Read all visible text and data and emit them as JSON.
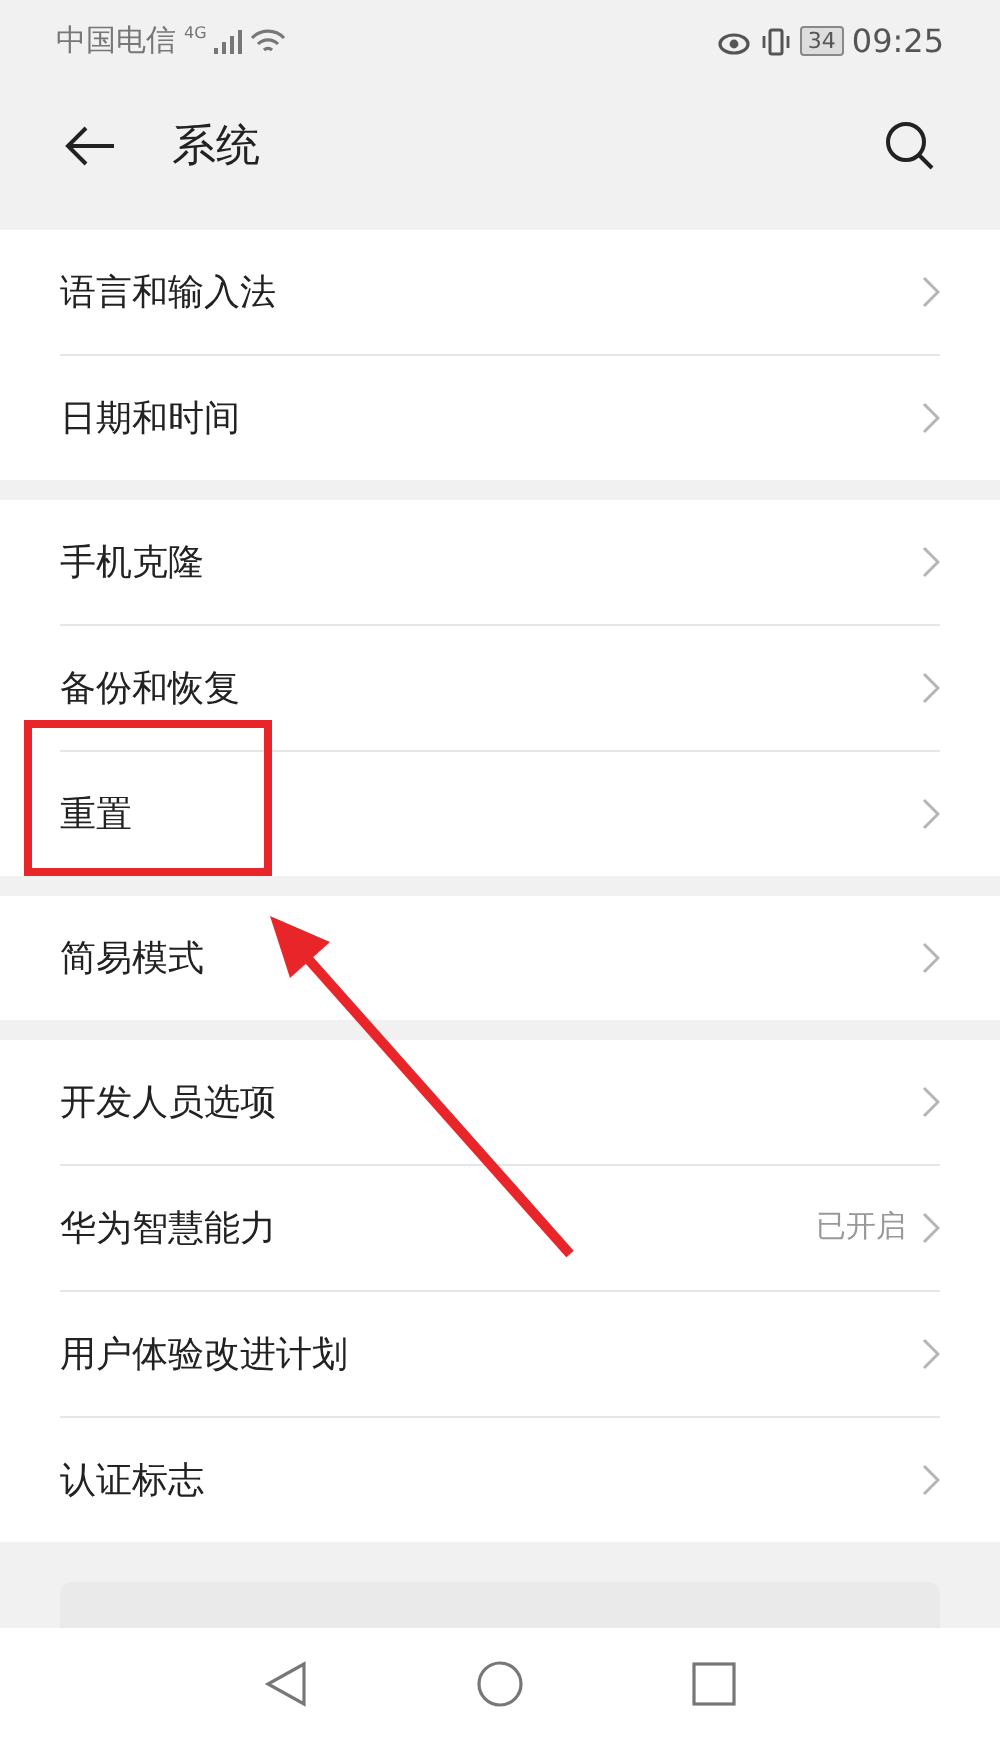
{
  "status_bar": {
    "carrier": "中国电信",
    "network": "4G",
    "battery": "34",
    "time": "09:25"
  },
  "header": {
    "title": "系统"
  },
  "groups": [
    {
      "items": [
        {
          "label": "语言和输入法"
        },
        {
          "label": "日期和时间"
        }
      ]
    },
    {
      "items": [
        {
          "label": "手机克隆"
        },
        {
          "label": "备份和恢复"
        },
        {
          "label": "重置"
        }
      ]
    },
    {
      "items": [
        {
          "label": "简易模式"
        }
      ]
    },
    {
      "items": [
        {
          "label": "开发人员选项"
        },
        {
          "label": "华为智慧能力",
          "value": "已开启"
        },
        {
          "label": "用户体验改进计划"
        },
        {
          "label": "认证标志"
        }
      ]
    }
  ]
}
